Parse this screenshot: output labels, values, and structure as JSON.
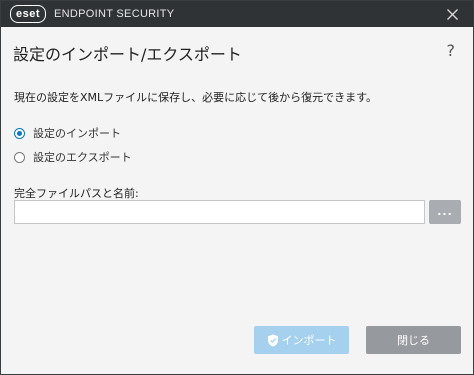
{
  "titlebar": {
    "logo": "eset",
    "product": "ENDPOINT SECURITY",
    "close_icon": "close-icon"
  },
  "dialog": {
    "title": "設定のインポート/エクスポート",
    "help": "?",
    "description": "現在の設定をXMLファイルに保存し、必要に応じて後から復元できます。"
  },
  "options": {
    "import_label": "設定のインポート",
    "export_label": "設定のエクスポート",
    "selected": "import"
  },
  "path": {
    "label": "完全ファイルパスと名前:",
    "value": "",
    "browse_label": "..."
  },
  "buttons": {
    "import_label": "インポート",
    "import_icon": "shield-icon",
    "close_label": "閉じる"
  },
  "colors": {
    "titlebar": "#2f3336",
    "accent": "#0a78c2",
    "import_button_disabled": "#a6d1ee",
    "close_button": "#969a9e"
  }
}
